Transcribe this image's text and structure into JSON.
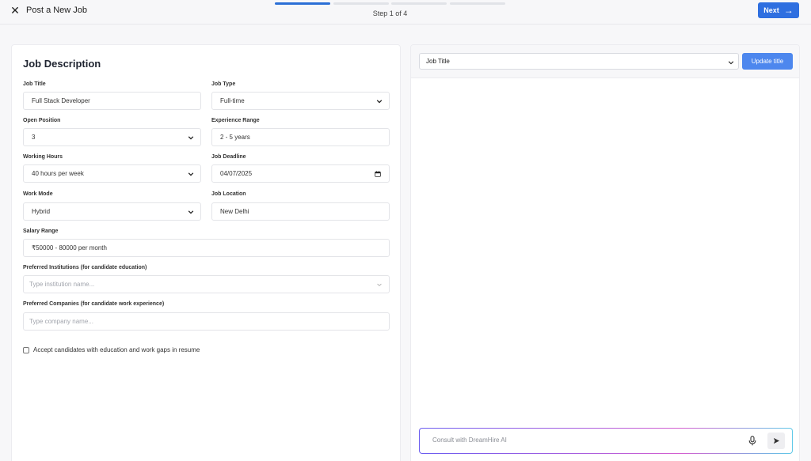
{
  "header": {
    "title": "Post a New Job",
    "close_icon": "close-icon",
    "step_label": "Step 1 of 4",
    "steps_total": 4,
    "current_step": 1,
    "next_label": "Next",
    "accent": "#2f6fe0"
  },
  "form": {
    "section_title": "Job Description",
    "job_title": {
      "label": "Job Title",
      "value": "Full Stack Developer"
    },
    "job_type": {
      "label": "Job Type",
      "value": "Full-time"
    },
    "open_position": {
      "label": "Open Position",
      "value": "3"
    },
    "experience_range": {
      "label": "Experience Range",
      "value": "2 - 5 years"
    },
    "working_hours": {
      "label": "Working Hours",
      "value": "40 hours per week"
    },
    "job_deadline": {
      "label": "Job Deadline",
      "value": "04/07/2025"
    },
    "work_mode": {
      "label": "Work Mode",
      "value": "Hybrid"
    },
    "job_location": {
      "label": "Job Location",
      "value": "New Delhi"
    },
    "salary_range": {
      "label": "Salary Range",
      "value": "₹50000 - 80000 per month"
    },
    "preferred_institutions": {
      "label": "Preferred Institutions (for candidate education)",
      "placeholder": "Type institution name..."
    },
    "preferred_companies": {
      "label": "Preferred Companies (for candidate work experience)",
      "placeholder": "Type company name..."
    },
    "gap_checkbox": {
      "label": "Accept candidates with education and work gaps in resume",
      "checked": false
    }
  },
  "preview": {
    "title_select": "Job Title",
    "update_label": "Update title",
    "chat_placeholder": "Consult with DreamHire AI",
    "mic_icon": "microphone-icon",
    "send_icon": "send-icon"
  }
}
